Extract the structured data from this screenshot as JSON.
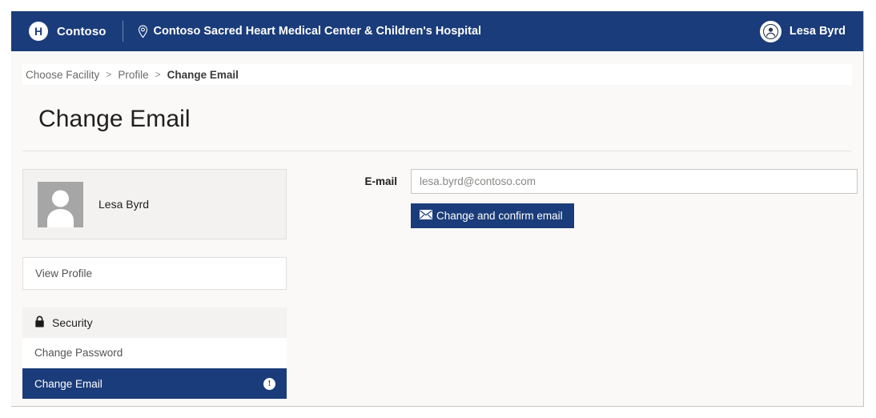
{
  "colors": {
    "navy": "#1b3c7a",
    "page_bg": "#faf9f8",
    "card_bg": "#f3f2f1",
    "border": "#e1dfdd",
    "text": "#201f1e",
    "muted_text": "#6b6b6b"
  },
  "topbar": {
    "logo_letter": "H",
    "brand": "Contoso",
    "facility": "Contoso Sacred Heart Medical Center & Children's Hospital",
    "user": "Lesa Byrd"
  },
  "breadcrumb": {
    "items": [
      {
        "label": "Choose Facility",
        "current": false
      },
      {
        "label": "Profile",
        "current": false
      },
      {
        "label": "Change Email",
        "current": true
      }
    ],
    "separator": ">"
  },
  "page": {
    "title": "Change Email"
  },
  "profile_card": {
    "name": "Lesa Byrd"
  },
  "sidebar": {
    "view_profile": "View Profile",
    "group_header": "Security",
    "items": [
      {
        "label": "Change Password",
        "active": false,
        "badge": ""
      },
      {
        "label": "Change Email",
        "active": true,
        "badge": "!"
      }
    ]
  },
  "form": {
    "email_label": "E-mail",
    "email_value": "",
    "email_placeholder": "lesa.byrd@contoso.com",
    "submit_label": "Change and confirm email"
  }
}
